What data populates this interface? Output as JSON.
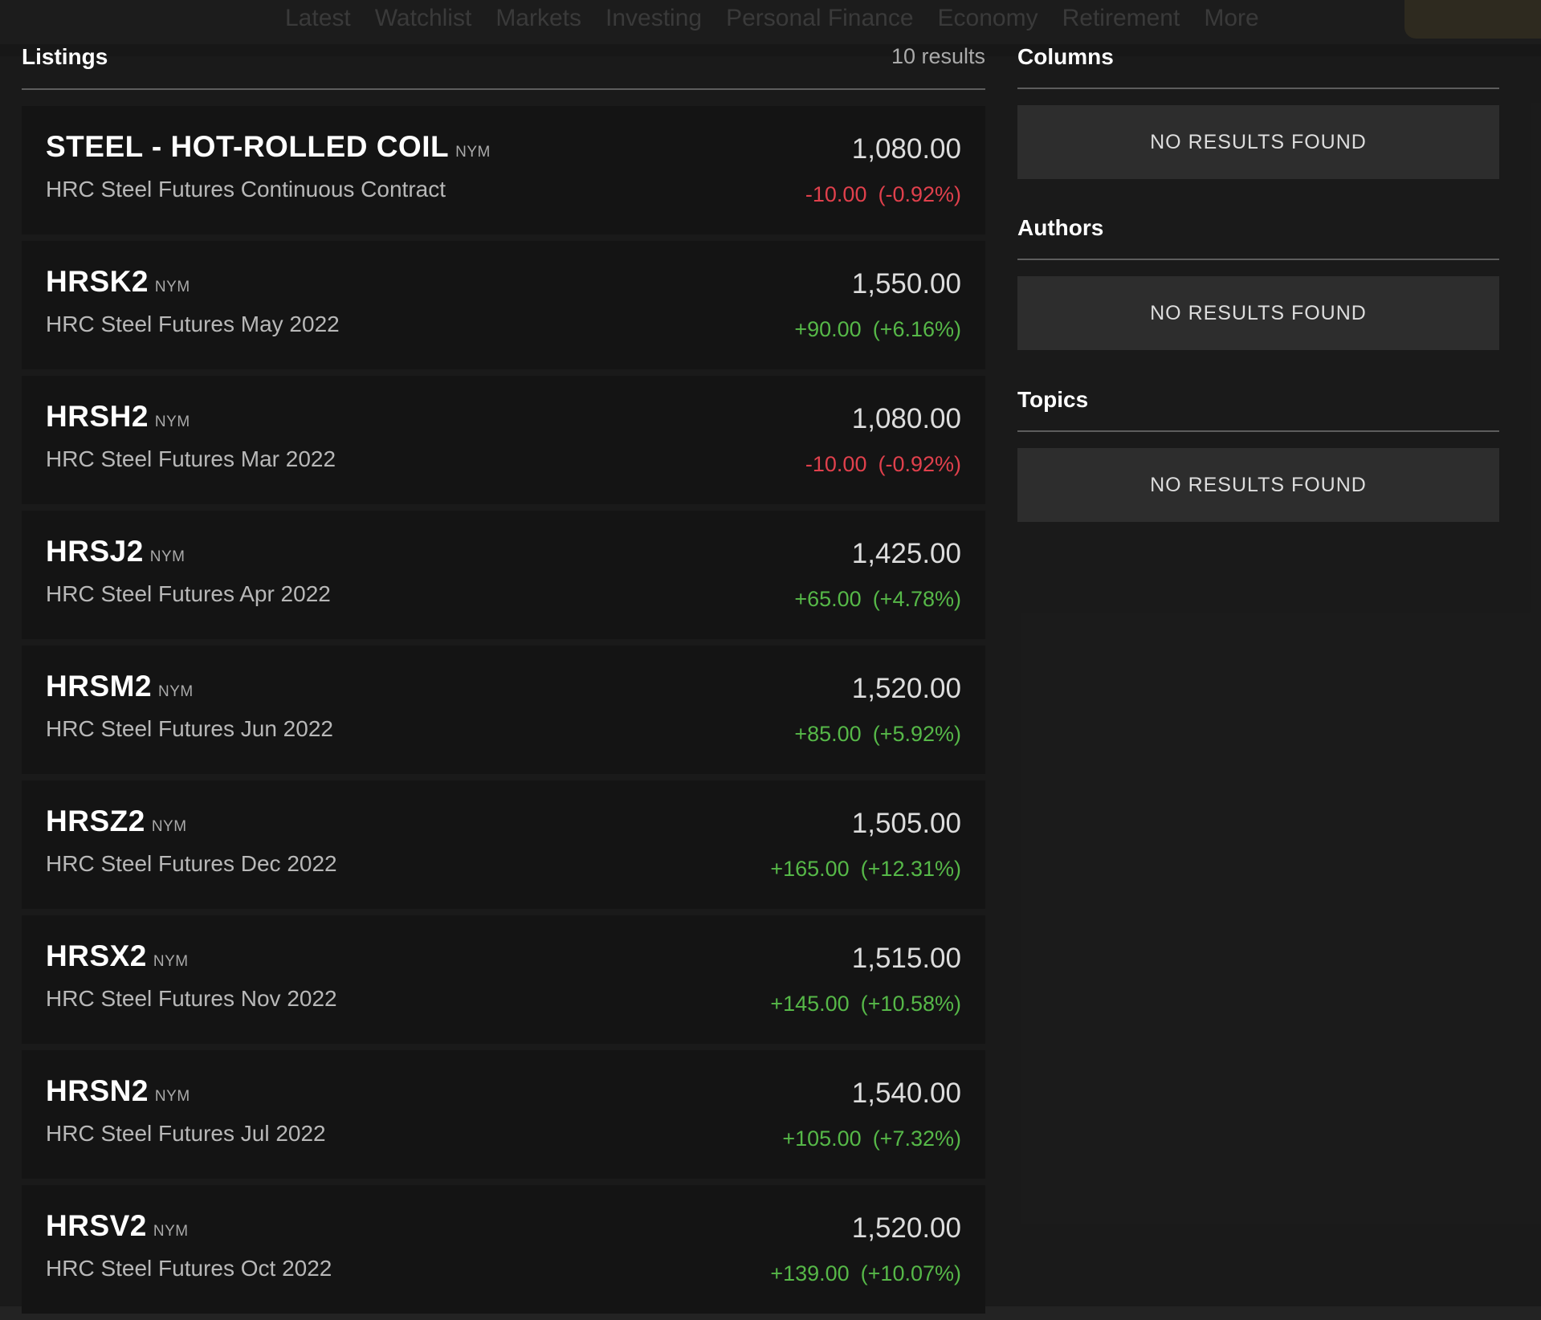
{
  "background_nav": {
    "links": [
      "Latest",
      "Watchlist",
      "Markets",
      "Investing",
      "Personal Finance",
      "Economy",
      "Retirement",
      "More"
    ]
  },
  "listings": {
    "title": "Listings",
    "count": "10 results",
    "items": [
      {
        "symbol": "STEEL - HOT-ROLLED COIL",
        "exchange": "NYM",
        "description": "HRC Steel Futures Continuous Contract",
        "price": "1,080.00",
        "change": "-10.00",
        "change_pct": "(-0.92%)",
        "direction": "neg"
      },
      {
        "symbol": "HRSK2",
        "exchange": "NYM",
        "description": "HRC Steel Futures May 2022",
        "price": "1,550.00",
        "change": "+90.00",
        "change_pct": "(+6.16%)",
        "direction": "pos"
      },
      {
        "symbol": "HRSH2",
        "exchange": "NYM",
        "description": "HRC Steel Futures Mar 2022",
        "price": "1,080.00",
        "change": "-10.00",
        "change_pct": "(-0.92%)",
        "direction": "neg"
      },
      {
        "symbol": "HRSJ2",
        "exchange": "NYM",
        "description": "HRC Steel Futures Apr 2022",
        "price": "1,425.00",
        "change": "+65.00",
        "change_pct": "(+4.78%)",
        "direction": "pos"
      },
      {
        "symbol": "HRSM2",
        "exchange": "NYM",
        "description": "HRC Steel Futures Jun 2022",
        "price": "1,520.00",
        "change": "+85.00",
        "change_pct": "(+5.92%)",
        "direction": "pos"
      },
      {
        "symbol": "HRSZ2",
        "exchange": "NYM",
        "description": "HRC Steel Futures Dec 2022",
        "price": "1,505.00",
        "change": "+165.00",
        "change_pct": "(+12.31%)",
        "direction": "pos"
      },
      {
        "symbol": "HRSX2",
        "exchange": "NYM",
        "description": "HRC Steel Futures Nov 2022",
        "price": "1,515.00",
        "change": "+145.00",
        "change_pct": "(+10.58%)",
        "direction": "pos"
      },
      {
        "symbol": "HRSN2",
        "exchange": "NYM",
        "description": "HRC Steel Futures Jul 2022",
        "price": "1,540.00",
        "change": "+105.00",
        "change_pct": "(+7.32%)",
        "direction": "pos"
      },
      {
        "symbol": "HRSV2",
        "exchange": "NYM",
        "description": "HRC Steel Futures Oct 2022",
        "price": "1,520.00",
        "change": "+139.00",
        "change_pct": "(+10.07%)",
        "direction": "pos"
      }
    ]
  },
  "columns": {
    "title": "Columns",
    "empty": "NO RESULTS FOUND"
  },
  "authors": {
    "title": "Authors",
    "empty": "NO RESULTS FOUND"
  },
  "topics": {
    "title": "Topics",
    "empty": "NO RESULTS FOUND"
  },
  "colors": {
    "negative": "#e0404c",
    "positive": "#56b848",
    "card_bg": "#141414",
    "panel_bg": "#2d2d2d"
  }
}
